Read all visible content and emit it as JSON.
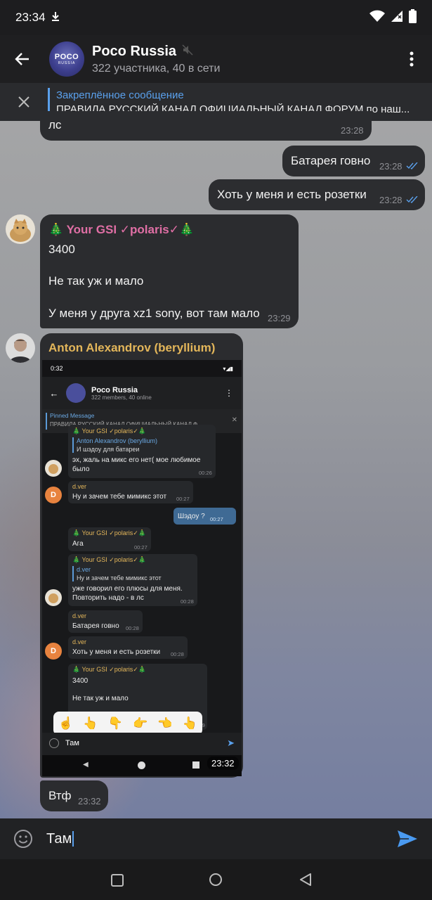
{
  "status_bar": {
    "time": "23:34",
    "download_icon": "download-icon"
  },
  "header": {
    "title": "Poco Russia",
    "subtitle": "322 участника, 40 в сети",
    "avatar_text_top": "POCO",
    "avatar_text_bottom": "RUSSIA"
  },
  "pinned": {
    "label": "Закреплённое сообщение",
    "text": "ПРАВИЛА РУССКИЙ КАНАЛ ОФИЦИАЛЬНЫЙ КАНАЛ ФОРУМ по наш..."
  },
  "messages": [
    {
      "text": "лс",
      "time": "23:28"
    },
    {
      "text": "Батарея говно",
      "time": "23:28"
    },
    {
      "text": "Хоть у меня и есть розетки",
      "time": "23:28"
    },
    {
      "sender": "🎄 Your GSI ✓polaris✓🎄",
      "lines": [
        "3400",
        "Не так уж и мало",
        "У меня у друга xz1 sony, вот там мало"
      ],
      "time": "23:29"
    },
    {
      "sender": "Anton Alexandrov (beryllium)",
      "time": "23:32"
    },
    {
      "text": "Втф",
      "time": "23:32"
    }
  ],
  "screenshot": {
    "status_time": "0:32",
    "title": "Poco Russia",
    "subtitle": "322 members, 40 online",
    "pinned_label": "Pinned Message",
    "pinned_text": "ПРАВИЛА РУССКИЙ КАНАЛ ОФИЦИАЛЬНЫЙ КАНАЛ Ф...",
    "m1": {
      "sender": "🎄 Your GSI ✓polaris✓🎄",
      "reply_name": "Anton Alexandrov (beryllium)",
      "reply_text": "И шэдоу для батареи",
      "line1": "эх, жаль на микс его нет( мое любимое",
      "line2": "было",
      "time": "00:26"
    },
    "m2": {
      "sender": "d.ver",
      "text": "Ну и зачем тебе мимикс этот",
      "time": "00:27"
    },
    "m3": {
      "text": "Шэдоу ?",
      "time": "00:27"
    },
    "m4": {
      "sender": "🎄 Your GSI ✓polaris✓🎄",
      "text": "Ага",
      "time": "00:27"
    },
    "m5": {
      "sender": "🎄 Your GSI ✓polaris✓🎄",
      "reply_name": "d.ver",
      "reply_text": "Ну и зачем тебе мимикс этот",
      "line1": "уже говорил его плюсы для меня.",
      "line2": "Повторить надо - в лс",
      "time": "00:28"
    },
    "m6": {
      "sender": "d.ver",
      "text": "Батарея говно",
      "time": "00:28"
    },
    "m7": {
      "sender": "d.ver",
      "text": "Хоть у меня и есть розетки",
      "time": "00:28"
    },
    "m8": {
      "sender": "🎄 Your GSI ✓polaris✓🎄",
      "line1": "3400",
      "line2": "Не так уж и мало",
      "time": "00:29"
    },
    "emoji_bar": [
      "☝️",
      "👆",
      "👇",
      "👉",
      "👈",
      "👆"
    ],
    "input_text": "Там",
    "avatar_letter": "D",
    "embedded_time": "23:32"
  },
  "input": {
    "text": "Там"
  }
}
